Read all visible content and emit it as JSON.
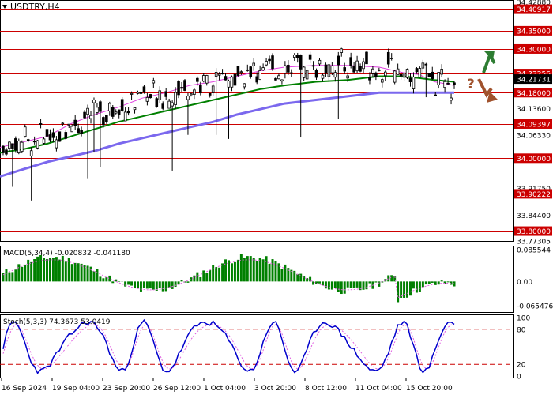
{
  "header": {
    "symbol_label": "USDTRY,H4"
  },
  "colors": {
    "background": "#ffffff",
    "candle": "#000000",
    "level_line": "#cc0000",
    "ma_fast": "#e040e0",
    "ma_mid": "#008000",
    "ma_slow": "#7b68ee",
    "macd_hist": "#008000",
    "macd_signal": "#e060e0",
    "stoch_main": "#0000cc",
    "stoch_signal": "#e060e0",
    "stoch_levels": "#cc0000",
    "label_box": "#cc0000",
    "label_text": "#ffffff",
    "price_box": "#000000",
    "arrow_up": "#2e7d32",
    "arrow_down": "#a0522d",
    "question": "#a0522d"
  },
  "annotations": {
    "question_mark": "?"
  },
  "chart_data": [
    {
      "type": "candlestick",
      "title": "USDTRY,H4",
      "ylim": [
        33.773,
        34.43
      ],
      "price_ticks": [
        "34.42880",
        "34.40917",
        "34.35000",
        "34.30000",
        "34.23256",
        "34.21731",
        "34.18000",
        "34.13600",
        "34.09397",
        "34.06330",
        "34.00000",
        "33.91750",
        "33.90222",
        "33.84400",
        "33.80000",
        "33.77305"
      ],
      "level_lines": [
        34.40917,
        34.35,
        34.3,
        34.23256,
        34.18,
        34.09397,
        34.0,
        33.90222,
        33.8
      ],
      "highlighted_levels": [
        "34.40917",
        "34.35000",
        "34.30000",
        "34.23256",
        "34.18000",
        "34.09397",
        "34.00000",
        "33.90222",
        "33.80000"
      ],
      "current_price": "34.21731",
      "moving_averages": [
        {
          "name": "fast",
          "points": [
            [
              0,
              34.03
            ],
            [
              30,
              34.045
            ],
            [
              60,
              34.06
            ],
            [
              90,
              34.095
            ],
            [
              120,
              34.12
            ],
            [
              150,
              34.14
            ],
            [
              180,
              34.165
            ],
            [
              210,
              34.18
            ],
            [
              240,
              34.2
            ],
            [
              270,
              34.21
            ],
            [
              300,
              34.225
            ],
            [
              330,
              34.24
            ],
            [
              360,
              34.25
            ],
            [
              400,
              34.255
            ],
            [
              440,
              34.255
            ],
            [
              480,
              34.25
            ],
            [
              510,
              34.235
            ],
            [
              530,
              34.23
            ],
            [
              550,
              34.21
            ],
            [
              575,
              34.2
            ]
          ]
        },
        {
          "name": "mid",
          "points": [
            [
              0,
              34.015
            ],
            [
              30,
              34.025
            ],
            [
              60,
              34.04
            ],
            [
              90,
              34.06
            ],
            [
              120,
              34.08
            ],
            [
              150,
              34.1
            ],
            [
              180,
              34.115
            ],
            [
              210,
              34.13
            ],
            [
              240,
              34.145
            ],
            [
              270,
              34.16
            ],
            [
              300,
              34.175
            ],
            [
              330,
              34.19
            ],
            [
              360,
              34.2
            ],
            [
              400,
              34.21
            ],
            [
              440,
              34.215
            ],
            [
              480,
              34.225
            ],
            [
              510,
              34.225
            ],
            [
              530,
              34.22
            ],
            [
              550,
              34.215
            ],
            [
              575,
              34.21
            ]
          ]
        },
        {
          "name": "slow",
          "points": [
            [
              0,
              33.95
            ],
            [
              30,
              33.97
            ],
            [
              60,
              33.99
            ],
            [
              90,
              34.005
            ],
            [
              120,
              34.02
            ],
            [
              150,
              34.04
            ],
            [
              180,
              34.055
            ],
            [
              210,
              34.07
            ],
            [
              240,
              34.085
            ],
            [
              270,
              34.1
            ],
            [
              300,
              34.12
            ],
            [
              330,
              34.135
            ],
            [
              360,
              34.15
            ],
            [
              400,
              34.16
            ],
            [
              440,
              34.17
            ],
            [
              480,
              34.18
            ],
            [
              510,
              34.18
            ],
            [
              530,
              34.18
            ],
            [
              550,
              34.18
            ],
            [
              575,
              34.18
            ]
          ]
        }
      ],
      "macd": {
        "label": "MACD(5,34,4) -0.020832 -0.041180",
        "ticks": [
          "0.085544",
          "0.00",
          "-0.065476"
        ],
        "ylim": [
          -0.08,
          0.09
        ]
      },
      "stochastic": {
        "label": "Stoch(5,3,3) 74.3673 53.0419",
        "ticks": [
          "100",
          "80",
          "20",
          "0"
        ],
        "levels": [
          80,
          20
        ]
      },
      "x_ticks": [
        "16 Sep 2024",
        "19 Sep 04:00",
        "23 Sep 20:00",
        "26 Sep 12:00",
        "1 Oct 04:00",
        "3 Oct 20:00",
        "8 Oct 12:00",
        "11 Oct 04:00",
        "15 Oct 20:00"
      ]
    }
  ]
}
